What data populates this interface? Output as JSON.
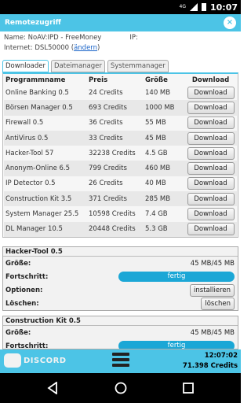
{
  "status": {
    "network": "4G",
    "time": "10:07"
  },
  "window": {
    "title": "Remotezugriff",
    "close": "×"
  },
  "info": {
    "name_label": "Name:",
    "name": "NoAV:IPD - FreeMoney",
    "ip_label": "IP:",
    "internet_label": "Internet:",
    "internet": "DSL50000",
    "change": "ändern"
  },
  "tabs": [
    "Downloader",
    "Dateimanager",
    "Systemmanager"
  ],
  "table": {
    "headers": [
      "Programmname",
      "Preis",
      "Größe",
      "Download"
    ],
    "rows": [
      {
        "name": "Online Banking 0.5",
        "price": "24 Credits",
        "size": "140 MB",
        "action": "Download"
      },
      {
        "name": "Börsen Manager 0.5",
        "price": "693 Credits",
        "size": "1000 MB",
        "action": "Download"
      },
      {
        "name": "Firewall 0.5",
        "price": "36 Credits",
        "size": "55 MB",
        "action": "Download"
      },
      {
        "name": "AntiVirus 0.5",
        "price": "33 Credits",
        "size": "45 MB",
        "action": "Download"
      },
      {
        "name": "Hacker-Tool 57",
        "price": "32238 Credits",
        "size": "4.5 GB",
        "action": "Download"
      },
      {
        "name": "Anonym-Online 6.5",
        "price": "799 Credits",
        "size": "460 MB",
        "action": "Download"
      },
      {
        "name": "IP Detector 0.5",
        "price": "26 Credits",
        "size": "40 MB",
        "action": "Download"
      },
      {
        "name": "Construction Kit 3.5",
        "price": "371 Credits",
        "size": "285 MB",
        "action": "Download"
      },
      {
        "name": "System Manager 25.5",
        "price": "10598 Credits",
        "size": "7.4 GB",
        "action": "Download"
      },
      {
        "name": "DL Manager 10.5",
        "price": "20448 Credits",
        "size": "5.3 GB",
        "action": "Download"
      }
    ]
  },
  "downloads": [
    {
      "title": "Hacker-Tool 0.5",
      "size_label": "Größe:",
      "size": "45 MB/45 MB",
      "progress_label": "Fortschritt:",
      "progress_text": "fertig",
      "progress": 1.0,
      "options_label": "Optionen:",
      "install": "installieren",
      "delete_label": "Löschen:",
      "delete": "löschen"
    },
    {
      "title": "Construction Kit 0.5",
      "size_label": "Größe:",
      "size": "45 MB/45 MB",
      "progress_label": "Fortschritt:",
      "progress_text": "fertig",
      "progress": 1.0
    }
  ],
  "footer": {
    "brand": "DISCORD",
    "time": "12:07:02",
    "credits": "71.398 Credits"
  },
  "colors": {
    "accent": "#4cc4e6",
    "progress": "#1ba7d6"
  },
  "icons": [
    "signal-icon",
    "battery-icon",
    "close-icon",
    "discord-icon",
    "menu-icon",
    "back-icon",
    "home-icon",
    "recents-icon"
  ]
}
